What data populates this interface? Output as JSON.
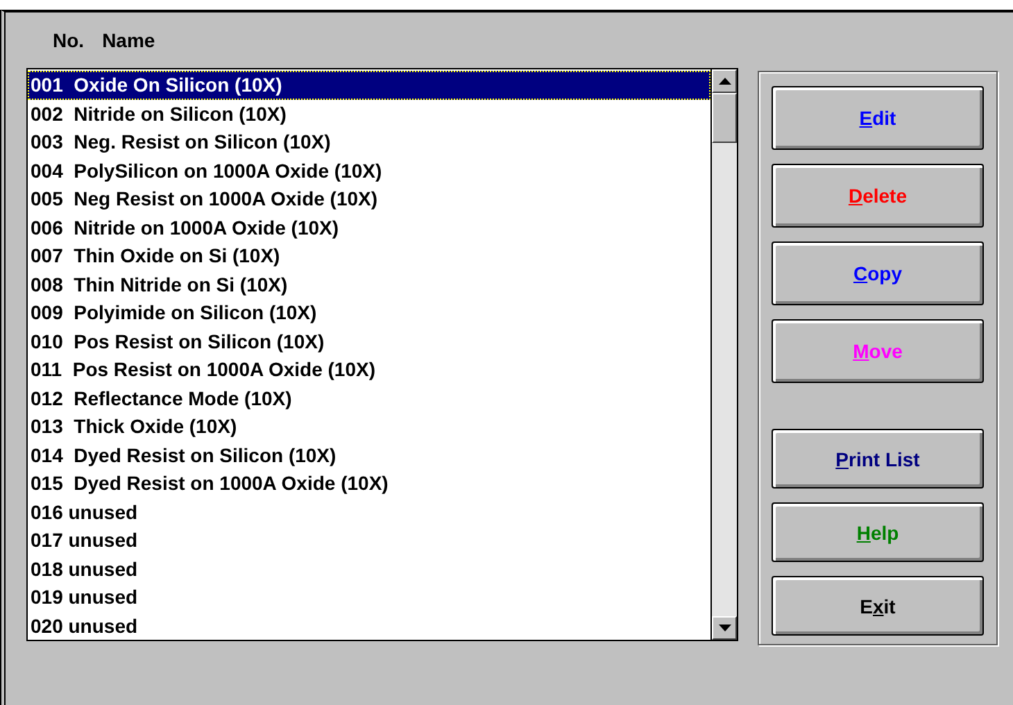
{
  "header": {
    "number_label": "No.",
    "name_label": "Name"
  },
  "items": [
    {
      "no": "001",
      "name": "Oxide On Silicon (10X)",
      "selected": true
    },
    {
      "no": "002",
      "name": "Nitride on Silicon (10X)",
      "selected": false
    },
    {
      "no": "003",
      "name": "Neg. Resist on Silicon (10X)",
      "selected": false
    },
    {
      "no": "004",
      "name": "PolySilicon on 1000A Oxide (10X)",
      "selected": false
    },
    {
      "no": "005",
      "name": "Neg Resist on 1000A Oxide (10X)",
      "selected": false
    },
    {
      "no": "006",
      "name": "Nitride on 1000A Oxide (10X)",
      "selected": false
    },
    {
      "no": "007",
      "name": "Thin Oxide on Si (10X)",
      "selected": false
    },
    {
      "no": "008",
      "name": "Thin Nitride on Si (10X)",
      "selected": false
    },
    {
      "no": "009",
      "name": "Polyimide on Silicon (10X)",
      "selected": false
    },
    {
      "no": "010",
      "name": "Pos Resist on Silicon (10X)",
      "selected": false
    },
    {
      "no": "011",
      "name": "Pos Resist on 1000A Oxide (10X)",
      "selected": false
    },
    {
      "no": "012",
      "name": "Reflectance Mode (10X)",
      "selected": false
    },
    {
      "no": "013",
      "name": "Thick Oxide (10X)",
      "selected": false
    },
    {
      "no": "014",
      "name": "Dyed Resist on Silicon (10X)",
      "selected": false
    },
    {
      "no": "015",
      "name": "Dyed Resist on 1000A Oxide (10X)",
      "selected": false
    },
    {
      "no": "016",
      "name": "unused",
      "selected": false
    },
    {
      "no": "017",
      "name": "unused",
      "selected": false
    },
    {
      "no": "018",
      "name": "unused",
      "selected": false
    },
    {
      "no": "019",
      "name": "unused",
      "selected": false
    },
    {
      "no": "020",
      "name": "unused",
      "selected": false
    }
  ],
  "buttons": [
    {
      "accel": "E",
      "after": "dit",
      "color": "#0000ff"
    },
    {
      "accel": "D",
      "after": "elete",
      "color": "#ff0000"
    },
    {
      "accel": "C",
      "after": "opy",
      "color": "#0000ff"
    },
    {
      "accel": "M",
      "after": "ove",
      "color": "#ff00ff"
    },
    {
      "accel": "P",
      "after": "rint List",
      "color": "#000080"
    },
    {
      "accel": "H",
      "after": "elp",
      "color": "#008000"
    },
    {
      "before": "E",
      "accel": "x",
      "after": "it",
      "color": "#000000"
    }
  ]
}
